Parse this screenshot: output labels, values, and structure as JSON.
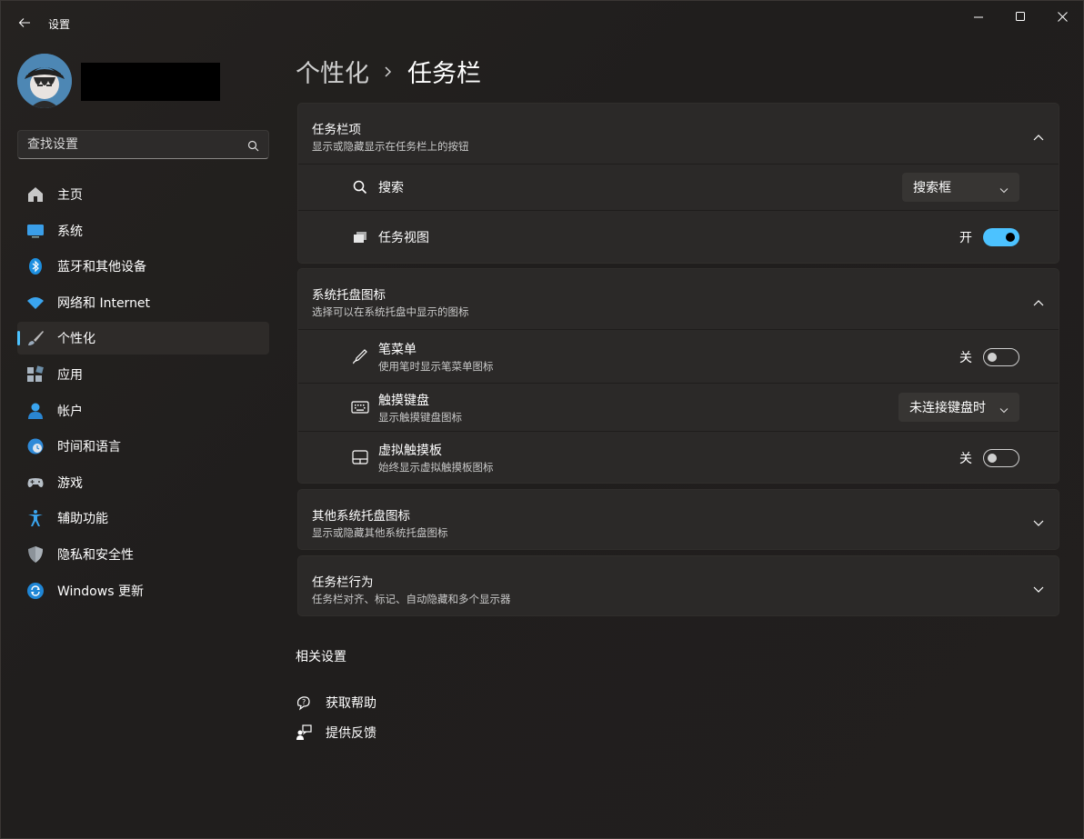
{
  "window": {
    "title": "设置"
  },
  "sidebar": {
    "search_placeholder": "查找设置",
    "items": [
      {
        "label": "主页",
        "icon": "home-icon"
      },
      {
        "label": "系统",
        "icon": "system-icon"
      },
      {
        "label": "蓝牙和其他设备",
        "icon": "bluetooth-icon"
      },
      {
        "label": "网络和 Internet",
        "icon": "wifi-icon"
      },
      {
        "label": "个性化",
        "icon": "brush-icon",
        "active": true
      },
      {
        "label": "应用",
        "icon": "apps-icon"
      },
      {
        "label": "帐户",
        "icon": "account-icon"
      },
      {
        "label": "时间和语言",
        "icon": "clock-icon"
      },
      {
        "label": "游戏",
        "icon": "gamepad-icon"
      },
      {
        "label": "辅助功能",
        "icon": "accessibility-icon"
      },
      {
        "label": "隐私和安全性",
        "icon": "shield-icon"
      },
      {
        "label": "Windows 更新",
        "icon": "update-icon"
      }
    ]
  },
  "breadcrumb": {
    "parent": "个性化",
    "current": "任务栏"
  },
  "sections": {
    "taskbar_items": {
      "title": "任务栏项",
      "subtitle": "显示或隐藏显示在任务栏上的按钮",
      "rows": {
        "search": {
          "label": "搜索",
          "value": "搜索框"
        },
        "task_view": {
          "label": "任务视图",
          "state": "开",
          "on": true
        }
      }
    },
    "tray_icons": {
      "title": "系统托盘图标",
      "subtitle": "选择可以在系统托盘中显示的图标",
      "rows": {
        "pen_menu": {
          "label": "笔菜单",
          "sub": "使用笔时显示笔菜单图标",
          "state": "关",
          "on": false
        },
        "touch_keyboard": {
          "label": "触摸键盘",
          "sub": "显示触摸键盘图标",
          "value": "未连接键盘时"
        },
        "virtual_touchpad": {
          "label": "虚拟触摸板",
          "sub": "始终显示虚拟触摸板图标",
          "state": "关",
          "on": false
        }
      }
    },
    "other_tray_icons": {
      "title": "其他系统托盘图标",
      "subtitle": "显示或隐藏其他系统托盘图标"
    },
    "taskbar_behaviors": {
      "title": "任务栏行为",
      "subtitle": "任务栏对齐、标记、自动隐藏和多个显示器"
    }
  },
  "related": {
    "title": "相关设置",
    "links": [
      {
        "label": "获取帮助",
        "icon": "help-icon"
      },
      {
        "label": "提供反馈",
        "icon": "feedback-icon"
      }
    ]
  },
  "colors": {
    "accent": "#4cc2ff",
    "background": "#201e1d",
    "card": "#2b2928"
  }
}
